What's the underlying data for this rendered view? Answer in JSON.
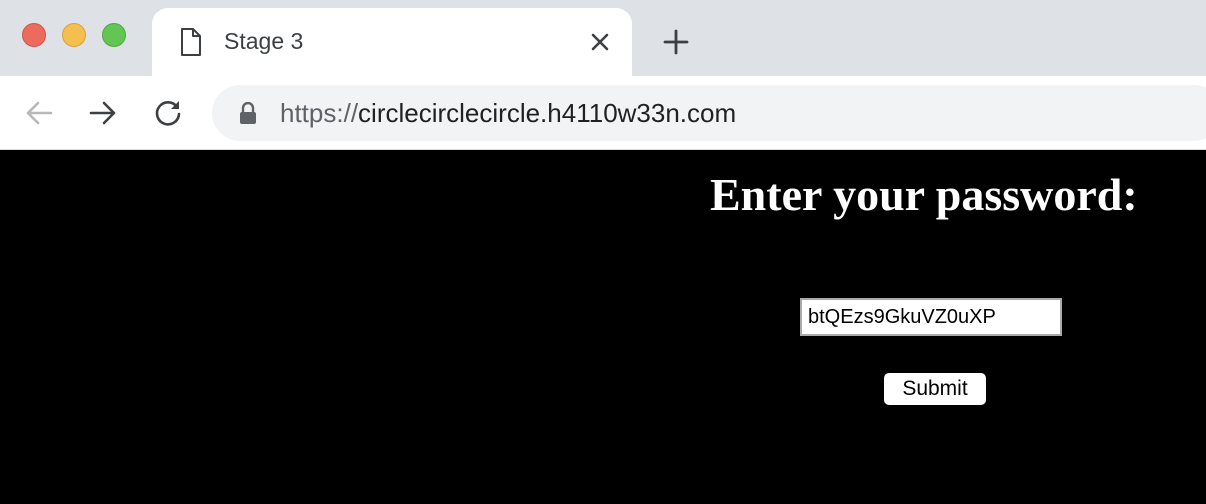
{
  "browser": {
    "tab": {
      "title": "Stage 3",
      "icon": "document-icon",
      "close_icon": "close-icon"
    },
    "new_tab_icon": "plus-icon",
    "nav": {
      "back_icon": "arrow-left-icon",
      "forward_icon": "arrow-right-icon",
      "reload_icon": "reload-icon"
    },
    "address_bar": {
      "lock_icon": "lock-icon",
      "scheme": "https://",
      "host": "circlecirclecircle.h4110w33n.com"
    },
    "window_controls": [
      "close",
      "minimize",
      "maximize"
    ]
  },
  "page": {
    "heading": "Enter your password:",
    "password_value": "btQEzs9GkuVZ0uXP",
    "submit_label": "Submit",
    "colors": {
      "background": "#000000",
      "text": "#ffffff"
    }
  }
}
